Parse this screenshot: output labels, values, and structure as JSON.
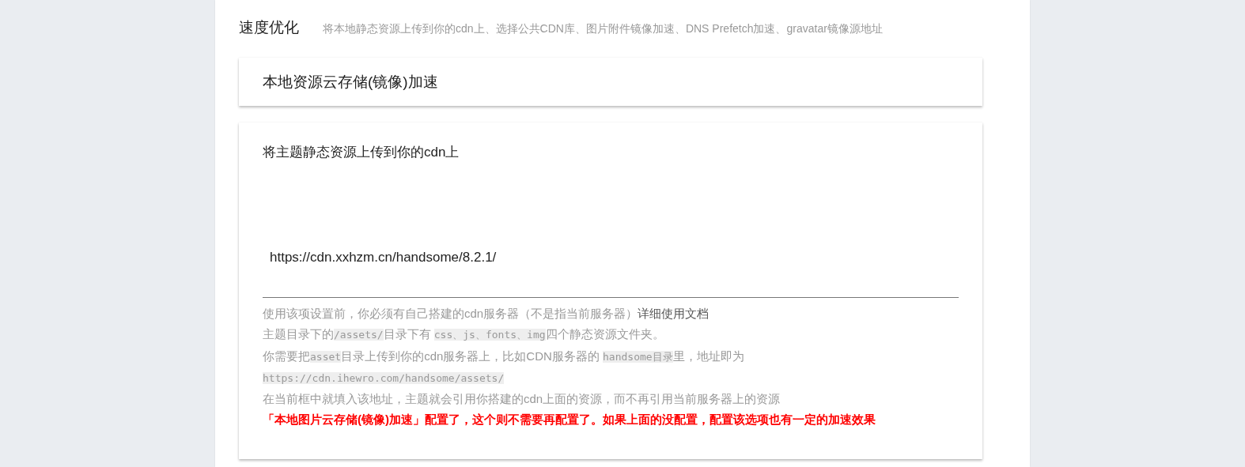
{
  "section": {
    "title": "速度优化",
    "description": "将本地静态资源上传到你的cdn上、选择公共CDN库、图片附件镜像加速、DNS Prefetch加速、gravatar镜像源地址"
  },
  "panels": [
    {
      "kind": "header",
      "title": "本地资源云存储(镜像)加速"
    },
    {
      "kind": "field",
      "label": "将主题静态资源上传到你的cdn上",
      "value": "https://cdn.xxhzm.cn/handsome/8.2.1/",
      "help": [
        [
          {
            "kind": "text",
            "text": "使用该项设置前，你必须有自己搭建的cdn服务器（不是指当前服务器）"
          },
          {
            "kind": "link",
            "text": "详细使用文档"
          }
        ],
        [
          {
            "kind": "text",
            "text": "主题目录下的"
          },
          {
            "kind": "code",
            "text": "/assets/"
          },
          {
            "kind": "text",
            "text": "目录下有 "
          },
          {
            "kind": "code",
            "text": "css、js、fonts、img"
          },
          {
            "kind": "text",
            "text": "四个静态资源文件夹。"
          }
        ],
        [
          {
            "kind": "text",
            "text": "你需要把"
          },
          {
            "kind": "code",
            "text": "asset"
          },
          {
            "kind": "text",
            "text": "目录上传到你的cdn服务器上，比如CDN服务器的 "
          },
          {
            "kind": "code",
            "text": "handsome目录"
          },
          {
            "kind": "text",
            "text": "里，地址即为"
          }
        ],
        [
          {
            "kind": "code",
            "text": "https://cdn.ihewro.com/handsome/assets/"
          }
        ],
        [
          {
            "kind": "text",
            "text": "在当前框中就填入该地址，主题就会引用你搭建的cdn上面的资源，而不再引用当前服务器上的资源"
          }
        ],
        [
          {
            "kind": "warning",
            "text": "「本地图片云存储(镜像)加速」配置了，这个则不需要再配置了。如果上面的没配置，配置该选项也有一定的加速效果"
          }
        ]
      ]
    }
  ]
}
